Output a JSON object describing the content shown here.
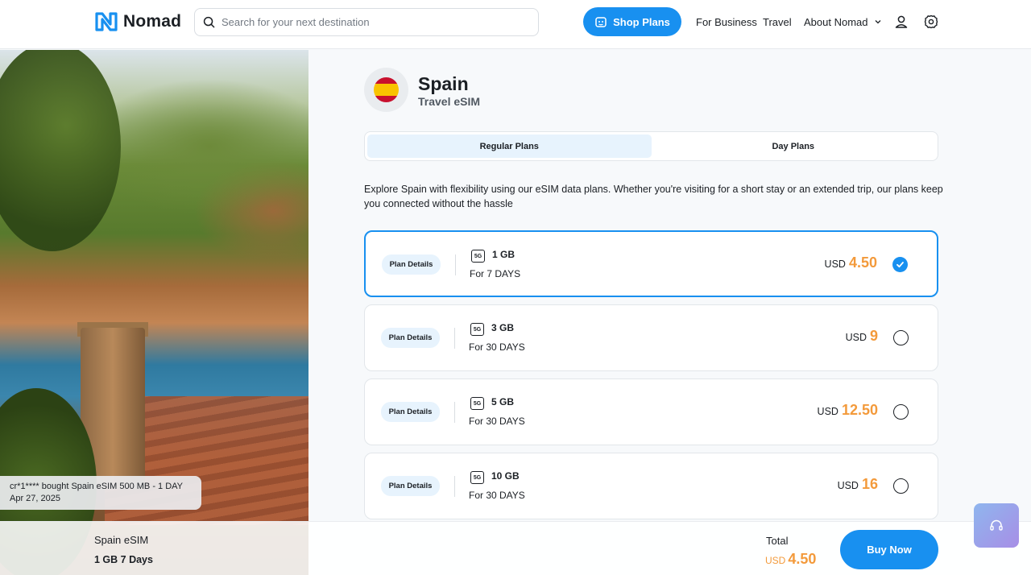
{
  "header": {
    "logo_text": "Nomad",
    "search_placeholder": "Search for your next destination",
    "shop_plans_label": "Shop Plans",
    "nav": [
      "For Business",
      "Travel",
      "About Nomad"
    ]
  },
  "toast": {
    "text": "cr*1**** bought Spain eSIM 500 MB - 1 DAY Apr 27, 2025"
  },
  "country": {
    "name": "Spain",
    "subtitle": "Travel eSIM"
  },
  "tabs": [
    {
      "label": "Regular Plans",
      "active": true
    },
    {
      "label": "Day Plans",
      "active": false
    }
  ],
  "description": "Explore Spain with flexibility using our eSIM data plans. Whether you're visiting for a short stay or an extended trip, our plans keep you connected without the hassle",
  "plans": [
    {
      "details_label": "Plan Details",
      "network": "5G",
      "data": "1 GB",
      "duration": "For 7 DAYS",
      "currency": "USD",
      "price": "4.50",
      "selected": true
    },
    {
      "details_label": "Plan Details",
      "network": "5G",
      "data": "3 GB",
      "duration": "For 30 DAYS",
      "currency": "USD",
      "price": "9",
      "selected": false
    },
    {
      "details_label": "Plan Details",
      "network": "5G",
      "data": "5 GB",
      "duration": "For 30 DAYS",
      "currency": "USD",
      "price": "12.50",
      "selected": false
    },
    {
      "details_label": "Plan Details",
      "network": "5G",
      "data": "10 GB",
      "duration": "For 30 DAYS",
      "currency": "USD",
      "price": "16",
      "selected": false
    }
  ],
  "bottom_bar": {
    "product": "Spain eSIM",
    "plan_summary": "1 GB 7 Days",
    "total_label": "Total",
    "total_currency": "USD",
    "total_amount": "4.50",
    "buy_label": "Buy Now"
  },
  "colors": {
    "accent": "#1890f0",
    "price": "#f39a3b",
    "tab_active": "#e7f3fd"
  },
  "icons": [
    "search-icon",
    "shop-icon",
    "chevron-down-icon",
    "user-icon",
    "gear-icon",
    "check-icon",
    "headset-icon"
  ]
}
